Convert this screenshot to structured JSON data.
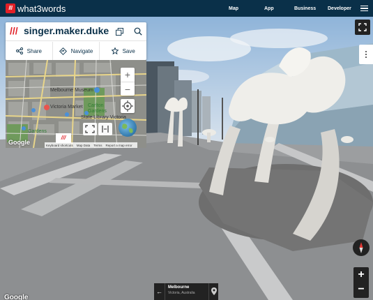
{
  "brand": {
    "mark": "///",
    "name": "what3words"
  },
  "nav": {
    "map": "Map",
    "app": "App",
    "business": "Business",
    "developer": "Developer"
  },
  "address": {
    "slashes": "///",
    "words": "singer.maker.duke"
  },
  "actions": {
    "share": "Share",
    "navigate": "Navigate",
    "save": "Save"
  },
  "minimap": {
    "labels": {
      "melbourne_museum": "Melbourne Museum",
      "victoria_market": "Victoria Market",
      "carlton_gardens": "Carlton Gardens",
      "state_library": "State Library Victoria",
      "gardens": "Gardens"
    },
    "google": "Google",
    "w3w_badge": "///",
    "attribution": {
      "keyboard": "Keyboard shortcuts",
      "map_data": "Map Data",
      "terms": "Terms",
      "report": "Report a map error"
    }
  },
  "location": {
    "title": "Melbourne",
    "subtitle": "Victoria, Australia"
  },
  "google_bottom": "Google",
  "colors": {
    "brand_red": "#e11f26",
    "navy": "#0a3049"
  }
}
